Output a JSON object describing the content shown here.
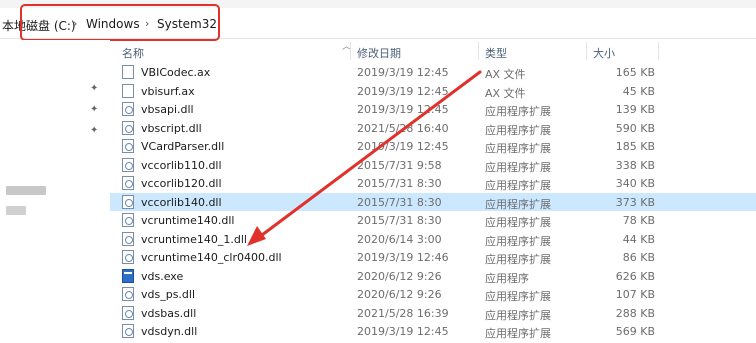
{
  "address": {
    "crumbs": [
      "本地磁盘 (C:)",
      "Windows",
      "System32"
    ],
    "separator": "›"
  },
  "nav": {
    "pin_glyph": "✦"
  },
  "columns": {
    "name": "名称",
    "date": "修改日期",
    "type": "类型",
    "size": "大小"
  },
  "files": [
    {
      "name": "VBICodec.ax",
      "date": "2019/3/19 12:45",
      "type": "AX 文件",
      "size": "165 KB",
      "icon": "file-icon"
    },
    {
      "name": "vbisurf.ax",
      "date": "2019/3/19 12:45",
      "type": "AX 文件",
      "size": "45 KB",
      "icon": "file-icon"
    },
    {
      "name": "vbsapi.dll",
      "date": "2019/3/19 12:45",
      "type": "应用程序扩展",
      "size": "139 KB",
      "icon": "dll-icon"
    },
    {
      "name": "vbscript.dll",
      "date": "2021/5/28 16:40",
      "type": "应用程序扩展",
      "size": "590 KB",
      "icon": "dll-icon"
    },
    {
      "name": "VCardParser.dll",
      "date": "2019/3/19 12:45",
      "type": "应用程序扩展",
      "size": "185 KB",
      "icon": "dll-icon"
    },
    {
      "name": "vccorlib110.dll",
      "date": "2015/7/31 9:58",
      "type": "应用程序扩展",
      "size": "338 KB",
      "icon": "dll-icon"
    },
    {
      "name": "vccorlib120.dll",
      "date": "2015/7/31 8:30",
      "type": "应用程序扩展",
      "size": "340 KB",
      "icon": "dll-icon"
    },
    {
      "name": "vccorlib140.dll",
      "date": "2015/7/31 8:30",
      "type": "应用程序扩展",
      "size": "373 KB",
      "icon": "dll-icon",
      "selected": true
    },
    {
      "name": "vcruntime140.dll",
      "date": "2015/7/31 8:30",
      "type": "应用程序扩展",
      "size": "78 KB",
      "icon": "dll-icon"
    },
    {
      "name": "vcruntime140_1.dll",
      "date": "2020/6/14 3:00",
      "type": "应用程序扩展",
      "size": "44 KB",
      "icon": "dll-icon"
    },
    {
      "name": "vcruntime140_clr0400.dll",
      "date": "2019/3/19 12:46",
      "type": "应用程序扩展",
      "size": "86 KB",
      "icon": "dll-icon"
    },
    {
      "name": "vds.exe",
      "date": "2020/6/12 9:26",
      "type": "应用程序",
      "size": "626 KB",
      "icon": "exe-icon"
    },
    {
      "name": "vds_ps.dll",
      "date": "2020/6/12 9:26",
      "type": "应用程序扩展",
      "size": "107 KB",
      "icon": "dll-icon"
    },
    {
      "name": "vdsbas.dll",
      "date": "2021/5/28 16:39",
      "type": "应用程序扩展",
      "size": "288 KB",
      "icon": "dll-icon"
    },
    {
      "name": "vdsdyn.dll",
      "date": "2019/3/19 12:45",
      "type": "应用程序扩展",
      "size": "569 KB",
      "icon": "dll-icon"
    }
  ],
  "colors": {
    "annotation_red": "#e1312b",
    "selection": "#cce8ff",
    "header_text": "#4c607a"
  }
}
